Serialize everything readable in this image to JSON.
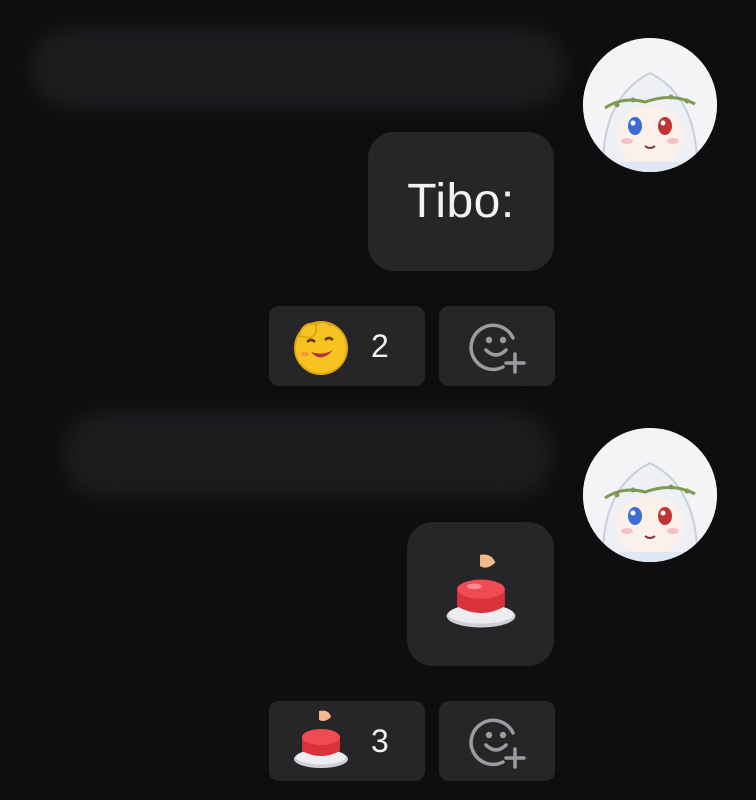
{
  "messages": [
    {
      "text": "Tibo:",
      "reaction": {
        "emoji": "yellow-smiley-hand-emoji",
        "count": "2"
      },
      "add_reaction_icon": "add-reaction-icon"
    },
    {
      "sticker": "red-button-press-sticker",
      "reaction": {
        "emoji": "red-button-emoji",
        "count": "3"
      },
      "add_reaction_icon": "add-reaction-icon"
    }
  ],
  "colors": {
    "background": "#0e0e10",
    "bubble": "#262628",
    "text": "#f2f2f2"
  }
}
